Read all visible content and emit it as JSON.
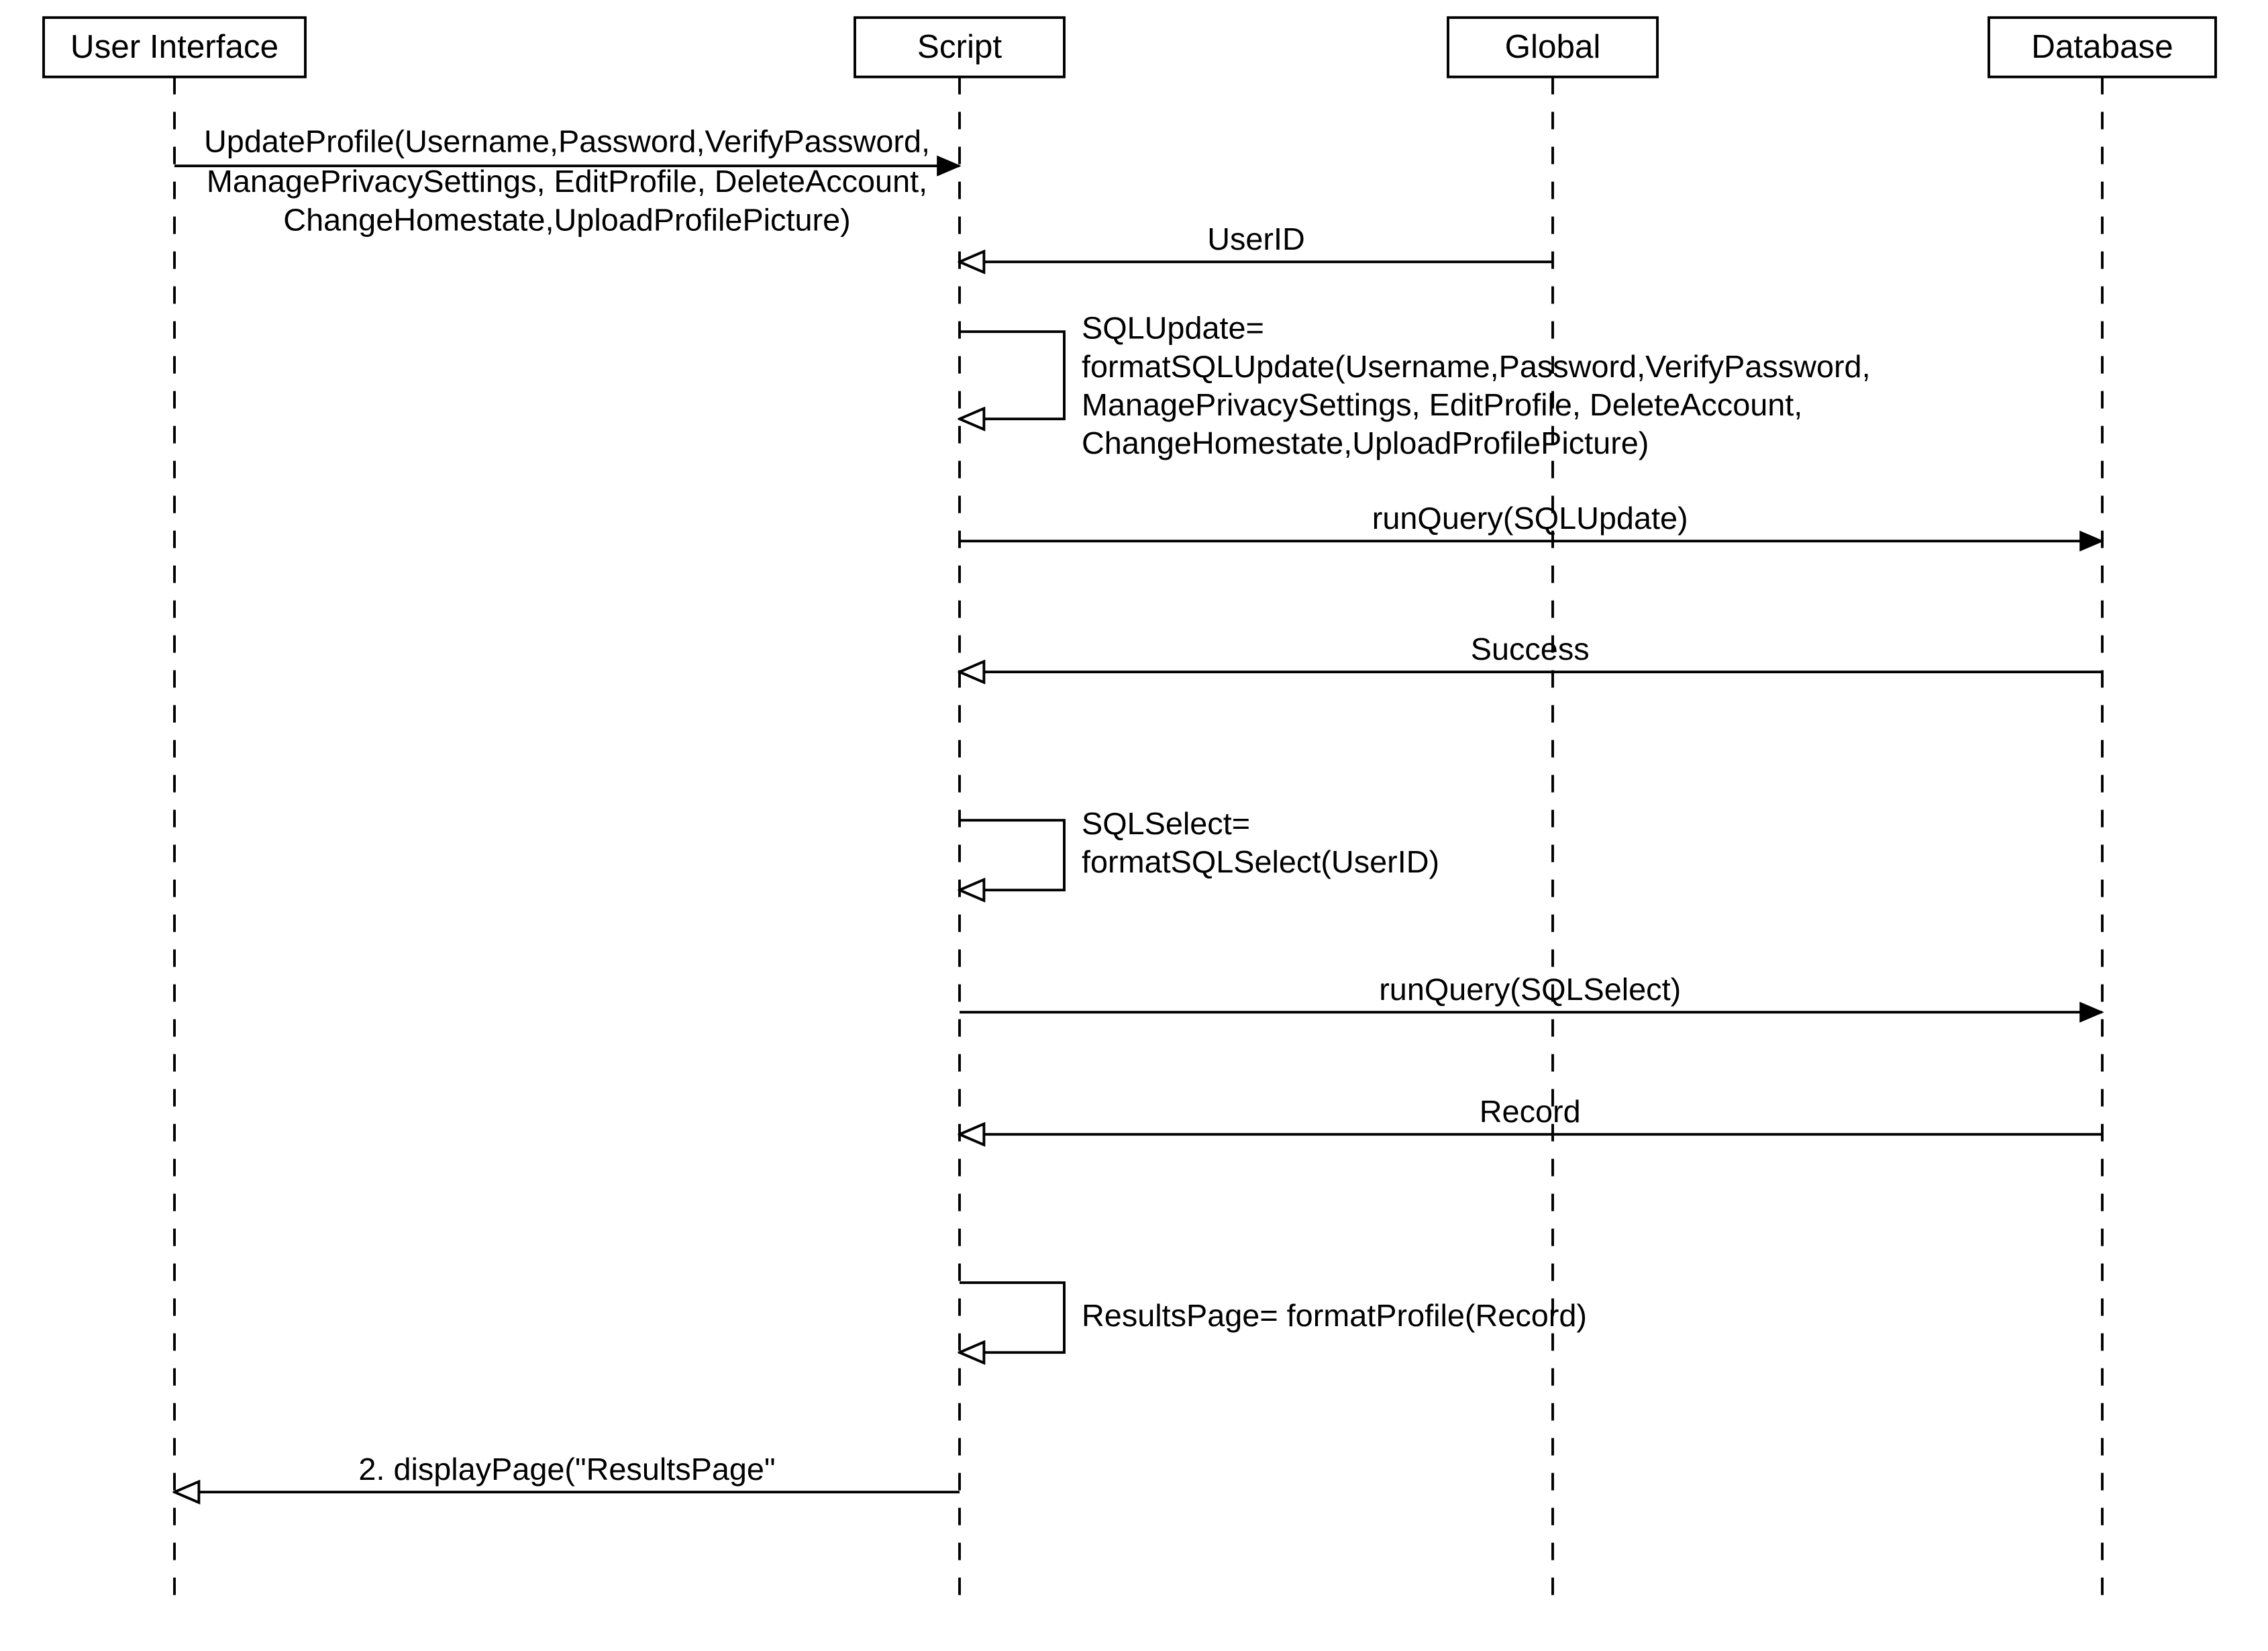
{
  "lifelines": {
    "ui": {
      "label": "User Interface"
    },
    "script": {
      "label": "Script"
    },
    "global": {
      "label": "Global"
    },
    "database": {
      "label": "Database"
    }
  },
  "messages": {
    "m1_l1": "UpdateProfile(Username,Password,VerifyPassword,",
    "m1_l2": "ManagePrivacySettings, EditProfile, DeleteAccount,",
    "m1_l3": "ChangeHomestate,UploadProfilePicture)",
    "m2": "UserID",
    "m3_l1": "SQLUpdate=",
    "m3_l2": "formatSQLUpdate(Username,Password,VerifyPassword,",
    "m3_l3": "ManagePrivacySettings, EditProfile, DeleteAccount,",
    "m3_l4": "ChangeHomestate,UploadProfilePicture)",
    "m4": "runQuery(SQLUpdate)",
    "m5": "Success",
    "m6_l1": "SQLSelect=",
    "m6_l2": "formatSQLSelect(UserID)",
    "m7": "runQuery(SQLSelect)",
    "m8": "Record",
    "m9": "ResultsPage= formatProfile(Record)",
    "m10": "2. displayPage(\"ResultsPage\""
  }
}
